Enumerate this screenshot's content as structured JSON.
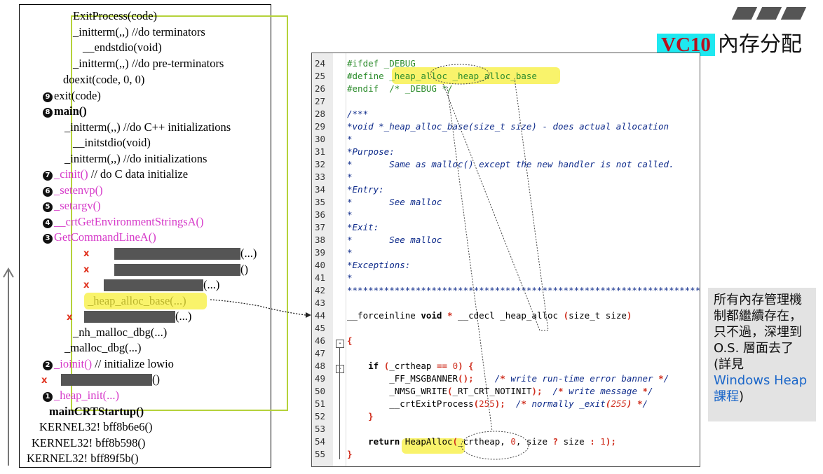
{
  "title": {
    "badge": "VC10",
    "rest": "內存分配"
  },
  "left_lines": [
    {
      "num": "",
      "text": "ExitProcess(code)",
      "style": ""
    },
    {
      "num": "",
      "text": "_initterm(,,)   //do terminators",
      "style": ""
    },
    {
      "num": "",
      "text": "__endstdio(void)",
      "style": ""
    },
    {
      "num": "",
      "text": "_initterm(,,)   //do pre-terminators",
      "style": ""
    },
    {
      "num": "",
      "text": "doexit(code, 0, 0)",
      "style": ""
    },
    {
      "num": "9",
      "text": "exit(code)",
      "style": ""
    },
    {
      "num": "8",
      "text": "main()",
      "style": "bold"
    },
    {
      "num": "",
      "text": "_initterm(,,)  //do C++ initializations",
      "style": ""
    },
    {
      "num": "",
      "text": "__initstdio(void)",
      "style": ""
    },
    {
      "num": "",
      "text": "_initterm(,,)  //do initializations",
      "style": ""
    },
    {
      "num": "7",
      "text": "_cinit()",
      "tail": "  // do C data initialize",
      "style": "mag"
    },
    {
      "num": "6",
      "text": "_setenvp()",
      "style": "mag"
    },
    {
      "num": "5",
      "text": "_setargv()",
      "style": "mag"
    },
    {
      "num": "4",
      "text": "__crtGetEnvironmentStringsA()",
      "style": "mag"
    },
    {
      "num": "3",
      "text": "GetCommandLineA()",
      "style": "mag"
    },
    {
      "num": "",
      "text": "(...)",
      "style": ""
    },
    {
      "num": "",
      "text": "()",
      "style": ""
    },
    {
      "num": "",
      "text": "(...)",
      "style": ""
    },
    {
      "num": "",
      "text": "_heap_alloc_base(...)",
      "style": ""
    },
    {
      "num": "",
      "text": "(...)",
      "style": ""
    },
    {
      "num": "",
      "text": "_nh_malloc_dbg(...)",
      "style": ""
    },
    {
      "num": "",
      "text": "_malloc_dbg(...)",
      "style": ""
    },
    {
      "num": "2",
      "text": "_ioinit()",
      "tail": "  // initialize lowio",
      "style": "mag"
    },
    {
      "num": "",
      "text": "()",
      "style": ""
    },
    {
      "num": "1",
      "text": "_heap_init(...)",
      "style": "mag"
    },
    {
      "num": "",
      "text": "mainCRTStartup()",
      "style": "bold"
    },
    {
      "num": "",
      "text": "KERNEL32! bff8b6e6()",
      "style": ""
    },
    {
      "num": "",
      "text": "KERNEL32! bff8b598()",
      "style": ""
    },
    {
      "num": "",
      "text": "KERNEL32! bff89f5b()",
      "style": ""
    }
  ],
  "red_x": "x",
  "code_lines": [
    {
      "n": "24",
      "t": "#ifdef _DEBUG"
    },
    {
      "n": "25",
      "t": "#define _heap_alloc _heap_alloc_base"
    },
    {
      "n": "26",
      "t": "#endif  /* _DEBUG */"
    },
    {
      "n": "27",
      "t": ""
    },
    {
      "n": "28",
      "t": "/***"
    },
    {
      "n": "29",
      "t": "*void *_heap_alloc_base(size_t size) - does actual allocation"
    },
    {
      "n": "30",
      "t": "*"
    },
    {
      "n": "31",
      "t": "*Purpose:"
    },
    {
      "n": "32",
      "t": "*       Same as malloc() except the new handler is not called."
    },
    {
      "n": "33",
      "t": "*"
    },
    {
      "n": "34",
      "t": "*Entry:"
    },
    {
      "n": "35",
      "t": "*       See malloc"
    },
    {
      "n": "36",
      "t": "*"
    },
    {
      "n": "37",
      "t": "*Exit:"
    },
    {
      "n": "38",
      "t": "*       See malloc"
    },
    {
      "n": "39",
      "t": "*"
    },
    {
      "n": "40",
      "t": "*Exceptions:"
    },
    {
      "n": "41",
      "t": "*"
    },
    {
      "n": "42",
      "t": "*******************************************************************************"
    },
    {
      "n": "43",
      "t": ""
    },
    {
      "n": "44",
      "t": "__forceinline void * __cdecl _heap_alloc (size_t size)"
    },
    {
      "n": "45",
      "t": ""
    },
    {
      "n": "46",
      "t": "{"
    },
    {
      "n": "47",
      "t": ""
    },
    {
      "n": "48",
      "t": "    if (_crtheap == 0) {"
    },
    {
      "n": "49",
      "t": "        _FF_MSGBANNER();    /* write run-time error banner */"
    },
    {
      "n": "50",
      "t": "        _NMSG_WRITE(_RT_CRT_NOTINIT);  /* write message */"
    },
    {
      "n": "51",
      "t": "        __crtExitProcess(255);  /* normally _exit(255) */"
    },
    {
      "n": "52",
      "t": "    }"
    },
    {
      "n": "53",
      "t": ""
    },
    {
      "n": "54",
      "t": "    return HeapAlloc(_crtheap, 0, size ? size : 1);"
    },
    {
      "n": "55",
      "t": "}"
    }
  ],
  "note": {
    "text": "所有內存管理機制都繼續存在，只不過，深埋到 O.S. 層面去了 (詳見",
    "link": "Windows Heap 課程",
    "tail": ")"
  }
}
